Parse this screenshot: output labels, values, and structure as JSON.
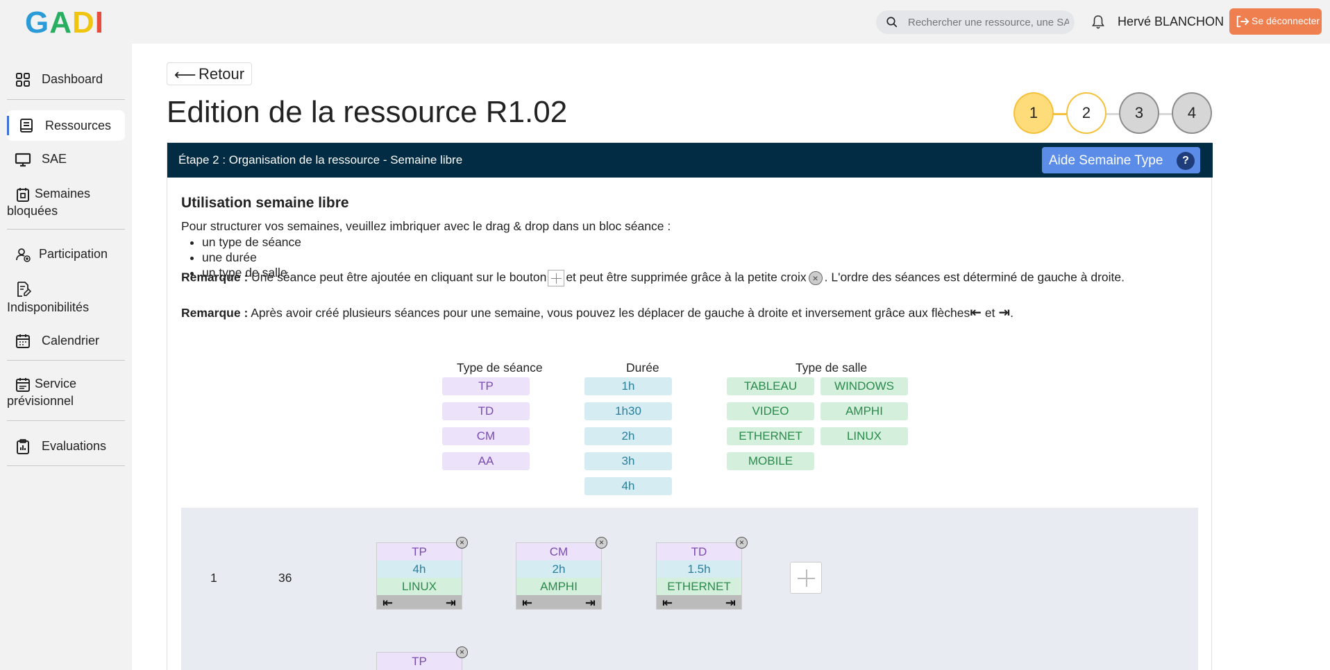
{
  "logo": {
    "letters": [
      "G",
      "A",
      "D",
      "I"
    ]
  },
  "header": {
    "search_placeholder": "Rechercher une ressource, une SAE ...",
    "user_name": "Hervé BLANCHON",
    "logout_label": "Se déconnecter"
  },
  "sidebar": {
    "items": [
      {
        "label": "Dashboard",
        "icon": "dashboard-icon"
      },
      {
        "label": "Ressources",
        "icon": "book-icon",
        "active": true
      },
      {
        "label": "SAE",
        "icon": "monitor-icon"
      },
      {
        "label": "Semaines bloquées",
        "icon": "blocked-calendar-icon"
      },
      {
        "label": "Participation",
        "icon": "user-add-icon"
      },
      {
        "label": "Indisponibilités",
        "icon": "document-edit-icon"
      },
      {
        "label": "Calendrier",
        "icon": "calendar-icon"
      },
      {
        "label": "Service prévisionnel",
        "icon": "calendar-check-icon"
      },
      {
        "label": "Evaluations",
        "icon": "clipboard-icon"
      }
    ]
  },
  "main": {
    "back_label": "Retour",
    "title": "Edition de la ressource R1.02",
    "steps": [
      "1",
      "2",
      "3",
      "4"
    ],
    "current_step": 2,
    "card": {
      "header": "Étape 2 : Organisation de la ressource - Semaine libre",
      "help_label": "Aide Semaine Type",
      "help_icon": "?",
      "section_title": "Utilisation semaine libre",
      "intro": "Pour structurer vos semaines, veuillez imbriquer avec le drag & drop dans un bloc séance :",
      "bullets": [
        "un type de séance",
        "une durée",
        "un type de salle"
      ],
      "remark1": {
        "label": "Remarque :",
        "part1": "Une séance peut être ajoutée en cliquant sur le bouton",
        "part2": "et peut être supprimée grâce à la petite croix",
        "part3": ". L'ordre des séances est déterminé de gauche à droite."
      },
      "remark2": {
        "label": "Remarque :",
        "part1": "Après avoir créé plusieurs séances pour une semaine, vous pouvez les déplacer de gauche à droite et inversement grâce aux flèches",
        "part2": "et",
        "part3": "."
      },
      "palette": {
        "seance_header": "Type de séance",
        "duree_header": "Durée",
        "salle_header": "Type de salle",
        "seances": [
          "TP",
          "TD",
          "CM",
          "AA"
        ],
        "durees": [
          "1h",
          "1h30",
          "2h",
          "3h",
          "4h"
        ],
        "salles": [
          "TABLEAU",
          "WINDOWS",
          "VIDEO",
          "AMPHI",
          "ETHERNET",
          "LINUX",
          "MOBILE"
        ]
      },
      "weeks": [
        {
          "index": "1",
          "number": "36",
          "sessions": [
            {
              "type": "TP",
              "duration": "4h",
              "room": "LINUX"
            },
            {
              "type": "CM",
              "duration": "2h",
              "room": "AMPHI"
            },
            {
              "type": "TD",
              "duration": "1.5h",
              "room": "ETHERNET"
            }
          ]
        },
        {
          "sessions": [
            {
              "type": "TP"
            }
          ]
        }
      ]
    }
  },
  "colors": {
    "header_bg": "#022c44",
    "help_button": "#5b8de8",
    "logout_button": "#f07f4f",
    "step_done": "#fedc7a",
    "seance_chip": "#ece2fa",
    "duree_chip": "#d4ecf2",
    "salle_chip": "#d4f0dd"
  }
}
